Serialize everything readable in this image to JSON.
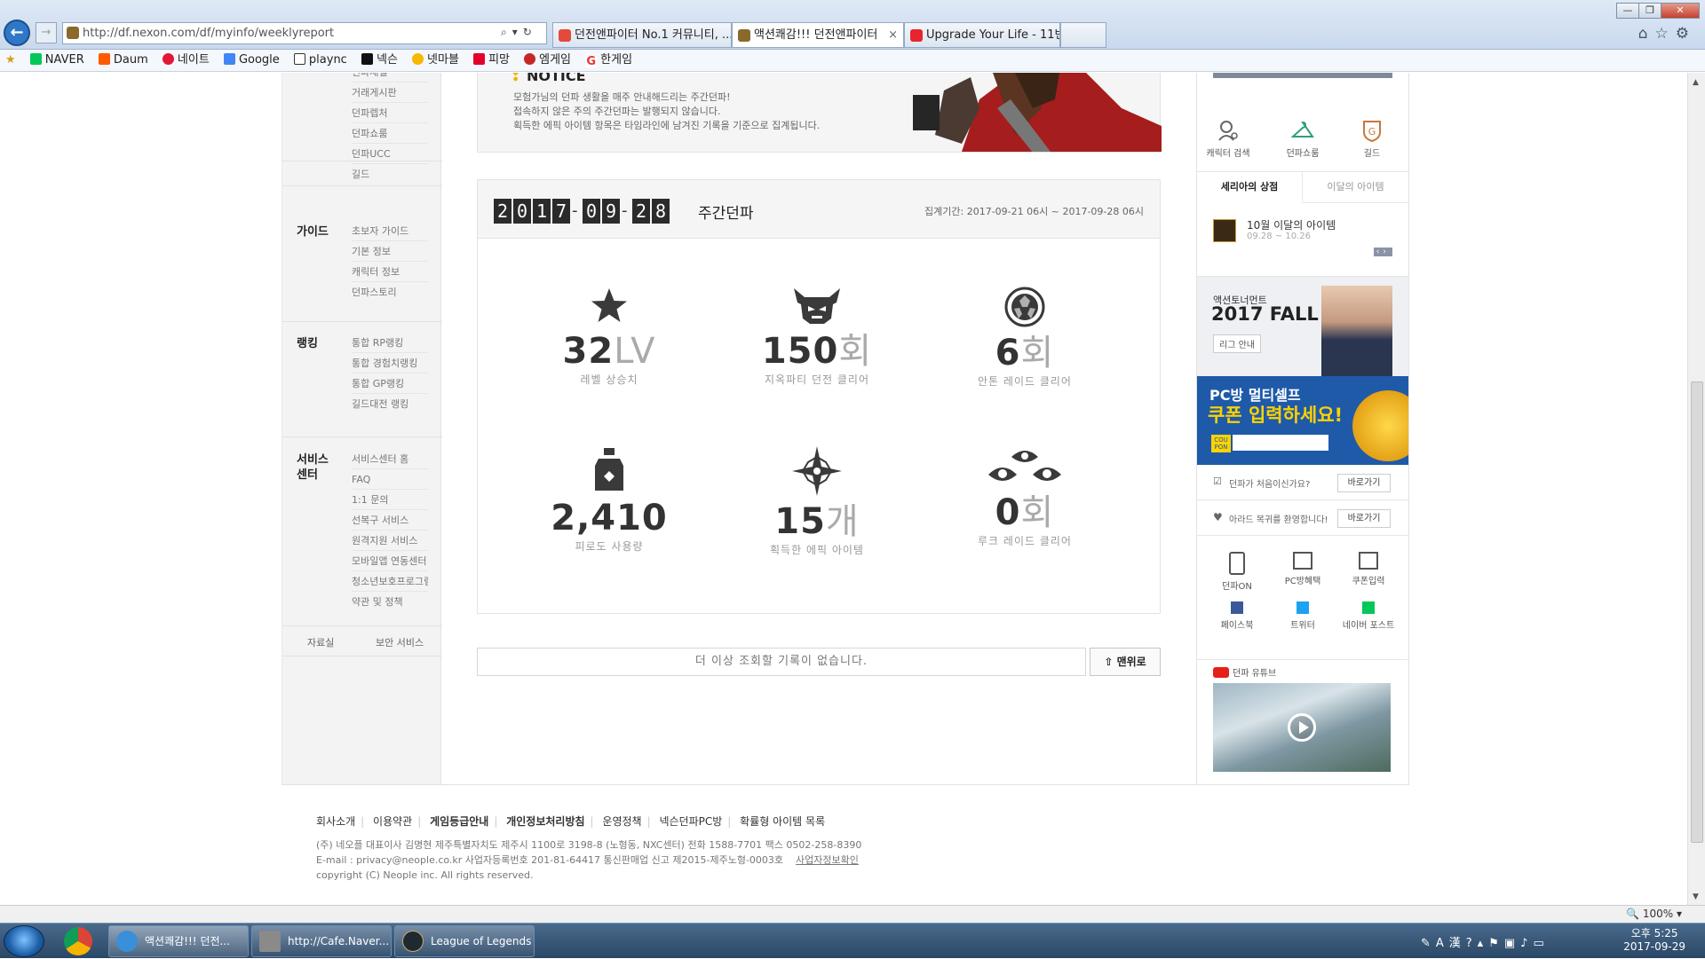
{
  "browser": {
    "url": "http://df.nexon.com/df/myinfo/weeklyreport",
    "tabs": [
      {
        "label": "던전앤파이터 No.1 커뮤니티, ...",
        "color": "#e34a3a"
      },
      {
        "label": "액션쾌감!!! 던전앤파이터",
        "color": "#8a6a2a"
      },
      {
        "label": "Upgrade Your Life - 11번가",
        "color": "#e8242f"
      }
    ],
    "window_buttons": [
      "—",
      "❐",
      "✕"
    ],
    "favorites": [
      "NAVER",
      "Daum",
      "네이트",
      "Google",
      "plaync",
      "넥슨",
      "넷마블",
      "피망",
      "엠게임",
      "한게임"
    ],
    "zoom": "100%"
  },
  "left_nav": {
    "groups": [
      {
        "title": "",
        "items": [
          "던파채널",
          "거래게시판",
          "던파렙처",
          "던파쇼룸",
          "던파UCC",
          "길드"
        ]
      },
      {
        "title": "가이드",
        "items": [
          "초보자 가이드",
          "기본 정보",
          "캐릭터 정보",
          "던파스토리"
        ]
      },
      {
        "title": "랭킹",
        "items": [
          "통합 RP랭킹",
          "통합 경험치랭킹",
          "통합 GP랭킹",
          "길드대전 랭킹"
        ]
      },
      {
        "title": "서비스 센터",
        "items": [
          "서비스센터 홈",
          "FAQ",
          "1:1 문의",
          "선복구 서비스",
          "원격지원 서비스",
          "모바일앱 연동센터",
          "청소년보호프로그램",
          "약관 및 정책"
        ]
      }
    ],
    "bottom": [
      "자료실",
      "보안 서비스"
    ]
  },
  "notice": {
    "title": "NOTICE",
    "lines": [
      "모험가님의 던파 생활을 매주 안내해드리는 주간던파!",
      "접속하지 않은 주의 주간던파는 발행되지 않습니다.",
      "획득한 에픽 아이템 항목은 타임라인에 남겨진 기록을 기준으로 집계됩니다."
    ]
  },
  "weekly": {
    "date_digits": [
      "2",
      "0",
      "1",
      "7",
      "-",
      "0",
      "9",
      "-",
      "2",
      "8"
    ],
    "title": "주간던파",
    "period": "집계기간: 2017-09-21 06시 ~ 2017-09-28 06시",
    "stats": [
      {
        "icon": "star-icon",
        "value": "32",
        "unit": "LV",
        "label": "레벨 상승치"
      },
      {
        "icon": "demon-head-icon",
        "value": "150",
        "unit": "회",
        "label": "지옥파티 던전 클리어"
      },
      {
        "icon": "turtle-shell-icon",
        "value": "6",
        "unit": "회",
        "label": "안톤 레이드 클리어"
      },
      {
        "icon": "potion-bottle-icon",
        "value": "2,410",
        "unit": "",
        "label": "피로도 사용량"
      },
      {
        "icon": "sparkle-star-icon",
        "value": "15",
        "unit": "개",
        "label": "획득한 에픽 아이템"
      },
      {
        "icon": "luke-eyes-icon",
        "value": "0",
        "unit": "회",
        "label": "루크 레이드 클리어"
      }
    ],
    "no_more": "더 이상 조회할 기록이 없습니다.",
    "to_top": "맨위로"
  },
  "right": {
    "quick": [
      "캐릭터 검색",
      "던파쇼룸",
      "길드"
    ],
    "tabs": [
      "세리아의 상점",
      "이달의 아이템"
    ],
    "shop_item": {
      "name": "10월 이달의 아이템",
      "date": "09.28 ~ 10.26"
    },
    "fall_banner": {
      "small": "액션토너먼트",
      "title": "2017 FALL",
      "button": "리그 안내"
    },
    "pc_banner": {
      "line1": "PC방 멀티셀프",
      "line2": "쿠폰 입력하세요!",
      "coupon": "COU PON"
    },
    "links": [
      {
        "text": "던파가 처음이신가요?",
        "button": "바로가기"
      },
      {
        "text": "아라드 복귀를 환영합니다!",
        "button": "바로가기"
      }
    ],
    "grid": [
      "던파ON",
      "PC방혜택",
      "쿠폰입력",
      "페이스북",
      "트위터",
      "네이버 포스트"
    ],
    "youtube": "던파 유튜브"
  },
  "footer": {
    "links": [
      "회사소개",
      "이용약관",
      "게임등급안내",
      "개인정보처리방침",
      "운영정책",
      "넥슨던파PC방",
      "확률형 아이템 목록"
    ],
    "info1": "(주) 네오플 대표이사 김명현    제주특별자치도 제주시 1100로 3198-8 (노형동, NXC센터)    전화 1588-7701    팩스 0502-258-8390",
    "info2": "E-mail : privacy@neople.co.kr    사업자등록번호 201-81-64417    통신판매업 신고 제2015-제주노형-0003호",
    "info2_link": "사업자정보확인",
    "copyright": "copyright (C) Neople inc. All rights reserved."
  },
  "taskbar": {
    "apps": [
      "액션쾌감!!! 던전...",
      "http://Cafe.Naver...",
      "League of Legends"
    ],
    "clock_time": "오후 5:25",
    "clock_date": "2017-09-29"
  }
}
